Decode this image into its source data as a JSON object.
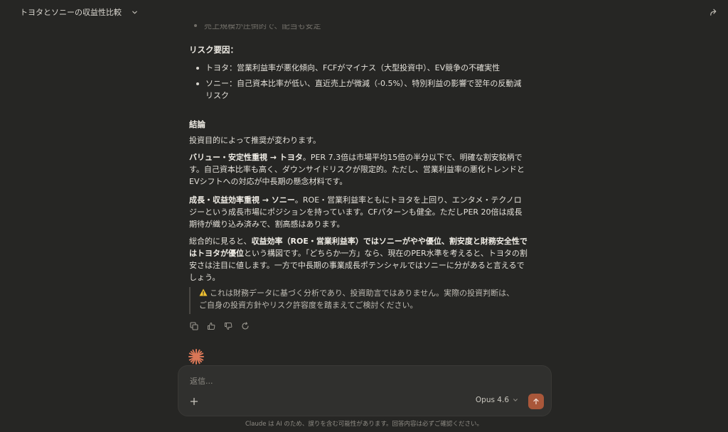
{
  "header": {
    "title": "トヨタとソニーの収益性比較"
  },
  "content": {
    "faded_bullet": "売上規模が圧倒的で、配当も安定",
    "risk_title": "リスク要因：",
    "risk_items": [
      "トヨタ：営業利益率が悪化傾向、FCFがマイナス（大型投資中）、EV競争の不確実性",
      "ソニー：自己資本比率が低い、直近売上が微減（-0.5%）、特別利益の影響で翌年の反動減リスク"
    ],
    "conclusion_title": "結論",
    "intro": "投資目的によって推奨が変わります。",
    "value_bold": "バリュー・安定性重視 → トヨタ",
    "value_text": "。PER 7.3倍は市場平均15倍の半分以下で、明確な割安銘柄です。自己資本比率も高く、ダウンサイドリスクが限定的。ただし、営業利益率の悪化トレンドとEVシフトへの対応が中長期の懸念材料です。",
    "growth_bold": "成長・収益効率重視 → ソニー",
    "growth_text": "。ROE・営業利益率ともにトヨタを上回り、エンタメ・テクノロジーという成長市場にポジションを持っています。CFパターンも健全。ただしPER 20倍は成長期待が織り込み済みで、割高感はあります。",
    "summary_pre": "総合的に見ると、",
    "summary_bold": "収益効率（ROE・営業利益率）ではソニーがやや優位、割安度と財務安全性ではトヨタが優位",
    "summary_post": "という構図です。「どちらか一方」なら、現在のPER水準を考えると、トヨタの割安さは注目に値します。一方で中長期の事業成長ポテンシャルではソニーに分があると言えるでしょう。",
    "disclaimer": "これは財務データに基づく分析であり、投資助言ではありません。実際の投資判断は、ご自身の投資方針やリスク許容度を踏まえてご検討ください。"
  },
  "composer": {
    "placeholder": "返信...",
    "model": "Opus 4.6"
  },
  "footer": {
    "text": "Claude は AI のため、誤りを含む可能性があります。回答内容は必ずご確認ください。"
  },
  "icons": [
    "chevron-down-icon",
    "share-icon",
    "warning-icon",
    "copy-icon",
    "thumbs-up-icon",
    "thumbs-down-icon",
    "retry-icon",
    "claude-spark-icon",
    "plus-icon",
    "arrow-up-icon"
  ],
  "colors": {
    "background": "#262624",
    "accent": "#d97757",
    "send_button": "#a9573a"
  }
}
